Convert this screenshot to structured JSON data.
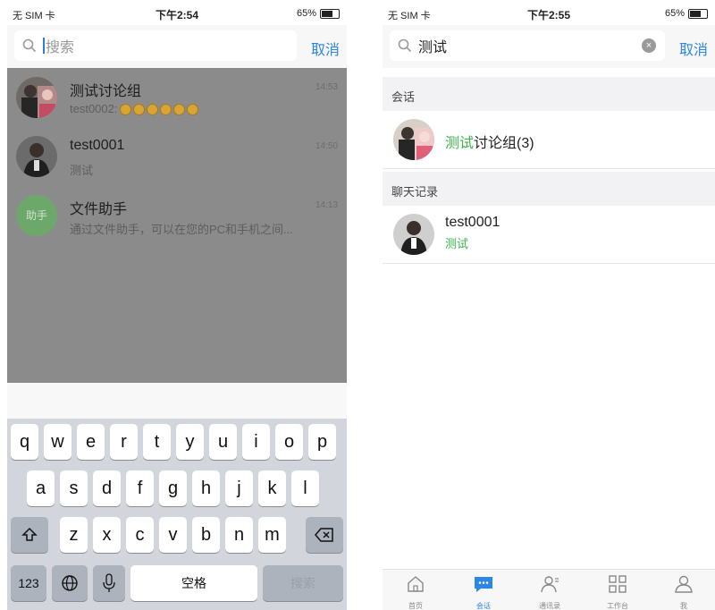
{
  "left": {
    "status": {
      "carrier": "无 SIM 卡",
      "time": "下午2:54",
      "battery": "65%"
    },
    "search": {
      "text": "搜索",
      "cancel": "取消"
    },
    "rows": [
      {
        "title": "测试讨论组",
        "sub": "test0002:",
        "time": "14:53"
      },
      {
        "title": "test0001",
        "sub": "测试",
        "time": "14:50"
      },
      {
        "title": "文件助手",
        "sub": "通过文件助手，可以在您的PC和手机之间...",
        "time": "14:13",
        "avatar_text": "助手"
      }
    ],
    "keyboard": {
      "row1": [
        "q",
        "w",
        "e",
        "r",
        "t",
        "y",
        "u",
        "i",
        "o",
        "p"
      ],
      "row2": [
        "a",
        "s",
        "d",
        "f",
        "g",
        "h",
        "j",
        "k",
        "l"
      ],
      "row3": [
        "z",
        "x",
        "c",
        "v",
        "b",
        "n",
        "m"
      ],
      "numbers": "123",
      "space": "空格",
      "search": "搜索"
    }
  },
  "right": {
    "status": {
      "carrier": "无 SIM 卡",
      "time": "下午2:55",
      "battery": "65%"
    },
    "search": {
      "value": "测试",
      "cancel": "取消"
    },
    "sections": {
      "conversations": "会话",
      "history": "聊天记录"
    },
    "conversation": {
      "highlight": "测试",
      "rest": "讨论组(3)"
    },
    "history_item": {
      "title": "test0001",
      "match": "测试"
    },
    "tabs": [
      {
        "label": "首页",
        "icon": "home-icon"
      },
      {
        "label": "会话",
        "icon": "chat-icon",
        "active": true
      },
      {
        "label": "通讯录",
        "icon": "contacts-icon"
      },
      {
        "label": "工作台",
        "icon": "apps-grid-icon"
      },
      {
        "label": "我",
        "icon": "profile-icon"
      }
    ]
  },
  "colors": {
    "accent": "#2b86e6",
    "highlight": "#3bb54a",
    "overlay": "#8b8b8b",
    "keyboard": "#d2d5db"
  }
}
